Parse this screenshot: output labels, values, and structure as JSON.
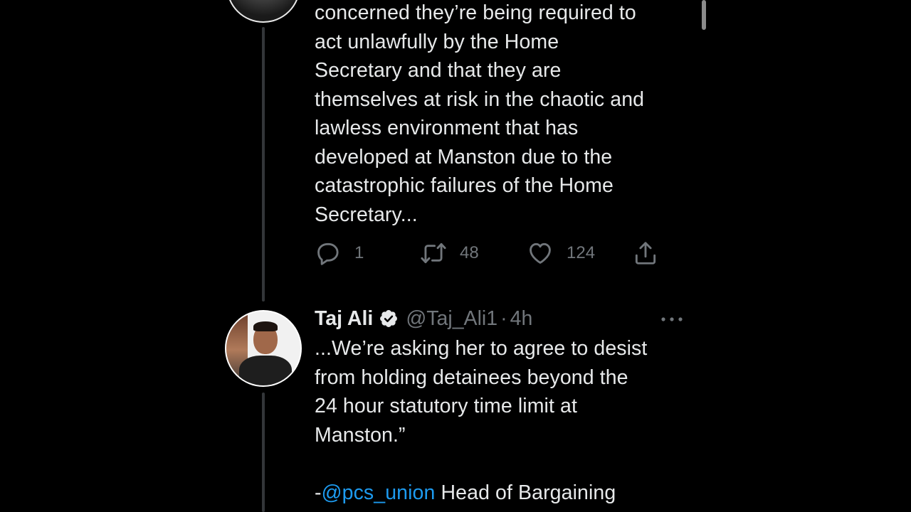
{
  "previous_tweet": {
    "text_lines": [
      "concerned they’re being required to",
      "act unlawfully by the Home",
      "Secretary and that they are",
      "themselves at risk in the chaotic and",
      "lawless environment that has",
      "developed at Manston due to the",
      "catastrophic failures of the Home",
      "Secretary..."
    ],
    "actions": {
      "reply_count": "1",
      "retweet_count": "48",
      "like_count": "124"
    }
  },
  "tweet": {
    "author_name": "Taj Ali",
    "handle": "@Taj_Ali1",
    "separator": "·",
    "time": "4h",
    "text_lines": [
      "...We’re asking her to agree to desist",
      "from holding detainees beyond the",
      "24 hour statutory time limit at",
      "Manston.”",
      ""
    ],
    "final_line": {
      "prefix": "-",
      "mention": "@pcs_union",
      "suffix": " Head of Bargaining"
    }
  },
  "icons": {
    "reply": "reply-icon",
    "retweet": "retweet-icon",
    "like": "heart-icon",
    "share": "share-icon",
    "verified": "verified-badge-icon",
    "more": "more-options-icon"
  },
  "colors": {
    "background": "#000000",
    "text": "#e7e9ea",
    "secondary": "#71767b",
    "link": "#1d9bf0",
    "thread_line": "#333639"
  }
}
